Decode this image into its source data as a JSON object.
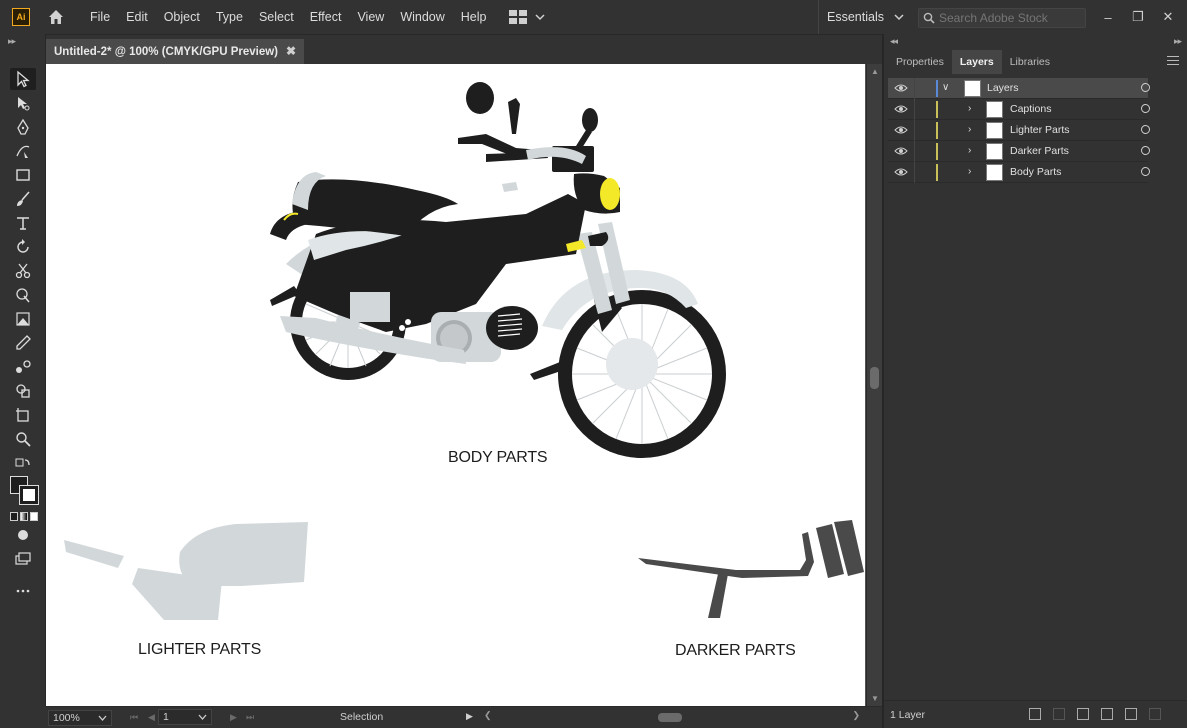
{
  "app": {
    "logo_text": "Ai",
    "menu": [
      "File",
      "Edit",
      "Object",
      "Type",
      "Select",
      "Effect",
      "View",
      "Window",
      "Help"
    ],
    "workspace": "Essentials",
    "search_placeholder": "Search Adobe Stock"
  },
  "document": {
    "tab_title": "Untitled-2* @ 100% (CMYK/GPU Preview)"
  },
  "artboard": {
    "captions": {
      "body": "BODY PARTS",
      "lighter": "LIGHTER PARTS",
      "darker": "DARKER PARTS"
    },
    "colors": {
      "dark": "#1e1e1e",
      "light": "#d2d8da",
      "headlight": "#f3e928",
      "darker_parts": "#4a4a4a"
    }
  },
  "statusbar": {
    "zoom": "100%",
    "page": "1",
    "tool": "Selection"
  },
  "panel": {
    "tabs": [
      "Properties",
      "Layers",
      "Libraries"
    ],
    "active_tab": "Layers",
    "root_layer": "Layers",
    "sublayers": [
      "Captions",
      "Lighter Parts",
      "Darker Parts",
      "Body Parts"
    ],
    "footer_count": "1 Layer"
  },
  "tools": [
    "selection-tool",
    "lasso-tool",
    "pen-tool",
    "curvature-tool",
    "rectangle-tool",
    "paintbrush-tool",
    "type-tool",
    "rotate-tool",
    "scissors-tool",
    "puppet-warp-tool",
    "free-transform-tool",
    "eyedropper-tool",
    "blend-tool",
    "shape-builder-tool",
    "artboard-tool",
    "zoom-tool"
  ]
}
